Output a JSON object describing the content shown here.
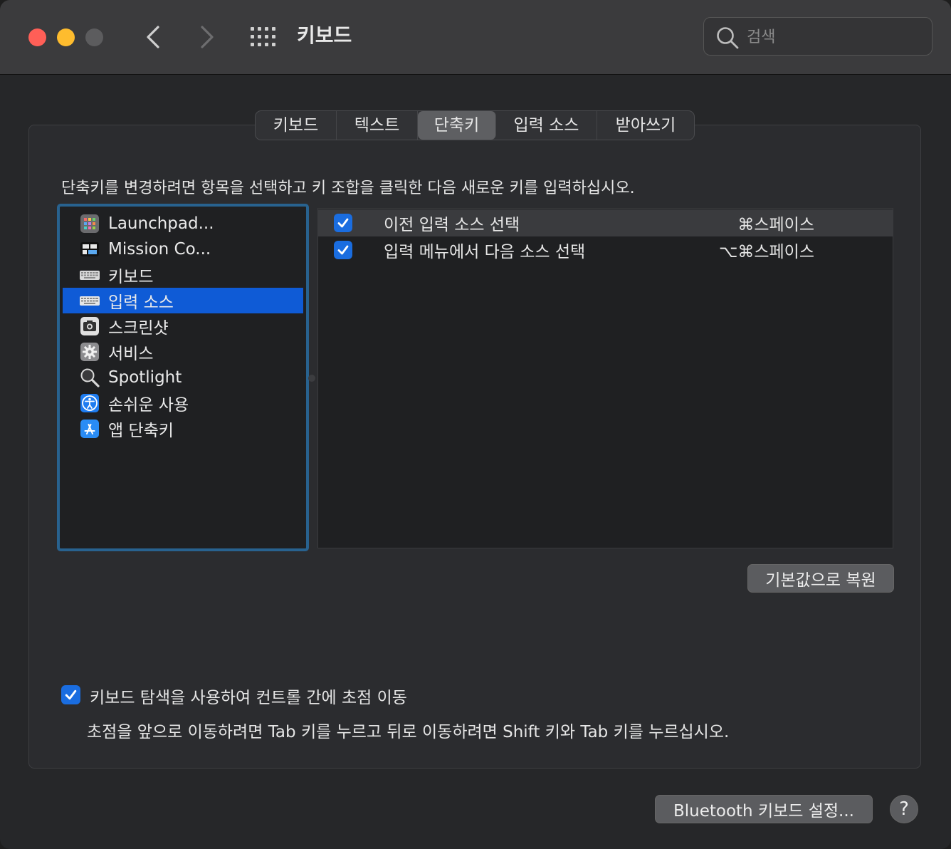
{
  "window": {
    "title": "키보드",
    "search_placeholder": "검색"
  },
  "tabs": [
    {
      "label": "키보드"
    },
    {
      "label": "텍스트"
    },
    {
      "label": "단축키",
      "active": true
    },
    {
      "label": "입력 소스"
    },
    {
      "label": "받아쓰기"
    }
  ],
  "instruction": "단축키를 변경하려면 항목을 선택하고 키 조합을 클릭한 다음 새로운 키를 입력하십시오.",
  "categories": [
    {
      "label": "Launchpad...",
      "icon": "launchpad-icon"
    },
    {
      "label": "Mission Co...",
      "icon": "mission-control-icon"
    },
    {
      "label": "키보드",
      "icon": "keyboard-icon"
    },
    {
      "label": "입력 소스",
      "icon": "keyboard-icon",
      "selected": true
    },
    {
      "label": "스크린샷",
      "icon": "screenshot-icon"
    },
    {
      "label": "서비스",
      "icon": "gear-icon"
    },
    {
      "label": "Spotlight",
      "icon": "magnifier-icon"
    },
    {
      "label": "손쉬운 사용",
      "icon": "accessibility-icon"
    },
    {
      "label": "앱 단축키",
      "icon": "app-store-icon"
    }
  ],
  "shortcuts": [
    {
      "checked": true,
      "name": "이전 입력 소스 선택",
      "keys": "⌘스페이스"
    },
    {
      "checked": true,
      "name": "입력 메뉴에서 다음 소스 선택",
      "keys": "⌥⌘스페이스"
    }
  ],
  "restore_button": "기본값으로 복원",
  "keyboard_navigation": {
    "checked": true,
    "label": "키보드 탐색을 사용하여 컨트롤 간에 초점 이동",
    "description": "초점을 앞으로 이동하려면 Tab 키를 누르고 뒤로 이동하려면 Shift 키와 Tab 키를 누르십시오."
  },
  "bluetooth_button": "Bluetooth 키보드 설정...",
  "help_button": "?",
  "colors": {
    "accent": "#0f5bd6",
    "checkbox": "#1a6de0",
    "close": "#ff5f57",
    "minimize": "#febc2e"
  }
}
